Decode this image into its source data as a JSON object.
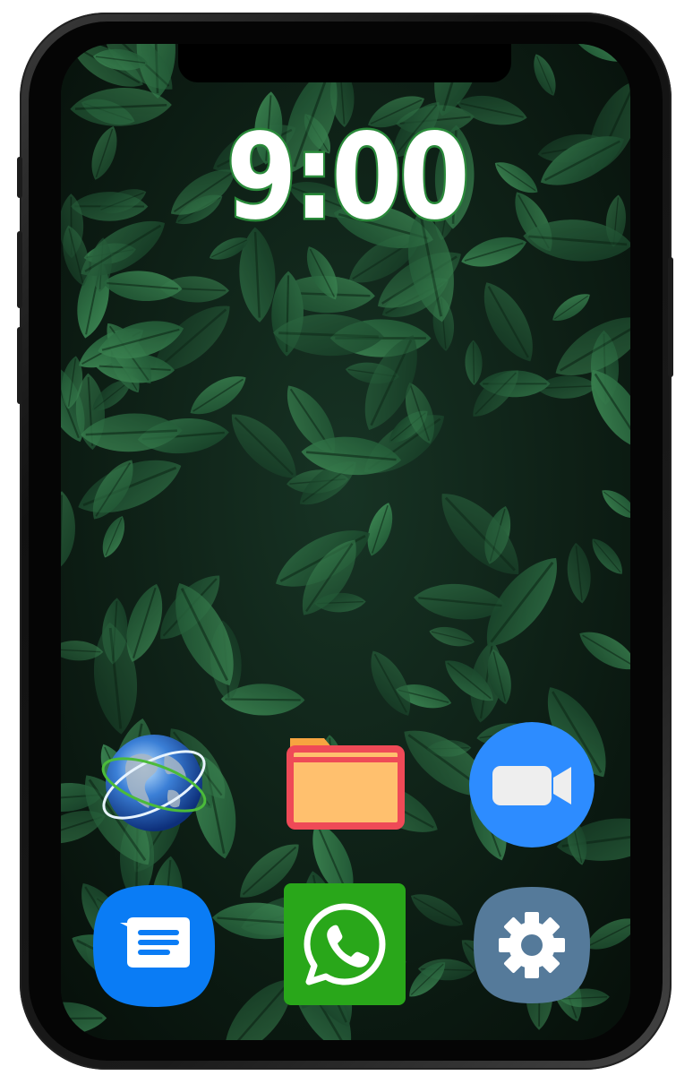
{
  "lockscreen": {
    "time": "9:00"
  },
  "apps": [
    {
      "name": "browser",
      "icon": "globe-icon"
    },
    {
      "name": "files",
      "icon": "folder-icon"
    },
    {
      "name": "video-call",
      "icon": "video-camera-icon"
    },
    {
      "name": "messages",
      "icon": "message-bubble-icon"
    },
    {
      "name": "whatsapp",
      "icon": "whatsapp-icon"
    },
    {
      "name": "settings",
      "icon": "gear-icon"
    }
  ],
  "colors": {
    "clock_outline": "#2a8a3a",
    "folder_fill": "#ffc06e",
    "folder_tab": "#f7a440",
    "folder_outline": "#ef4a57",
    "video_bg": "#2d8cff",
    "messages_bg": "#0a7cf5",
    "whatsapp_bg": "#29a71a",
    "settings_bg": "#557a9a"
  }
}
